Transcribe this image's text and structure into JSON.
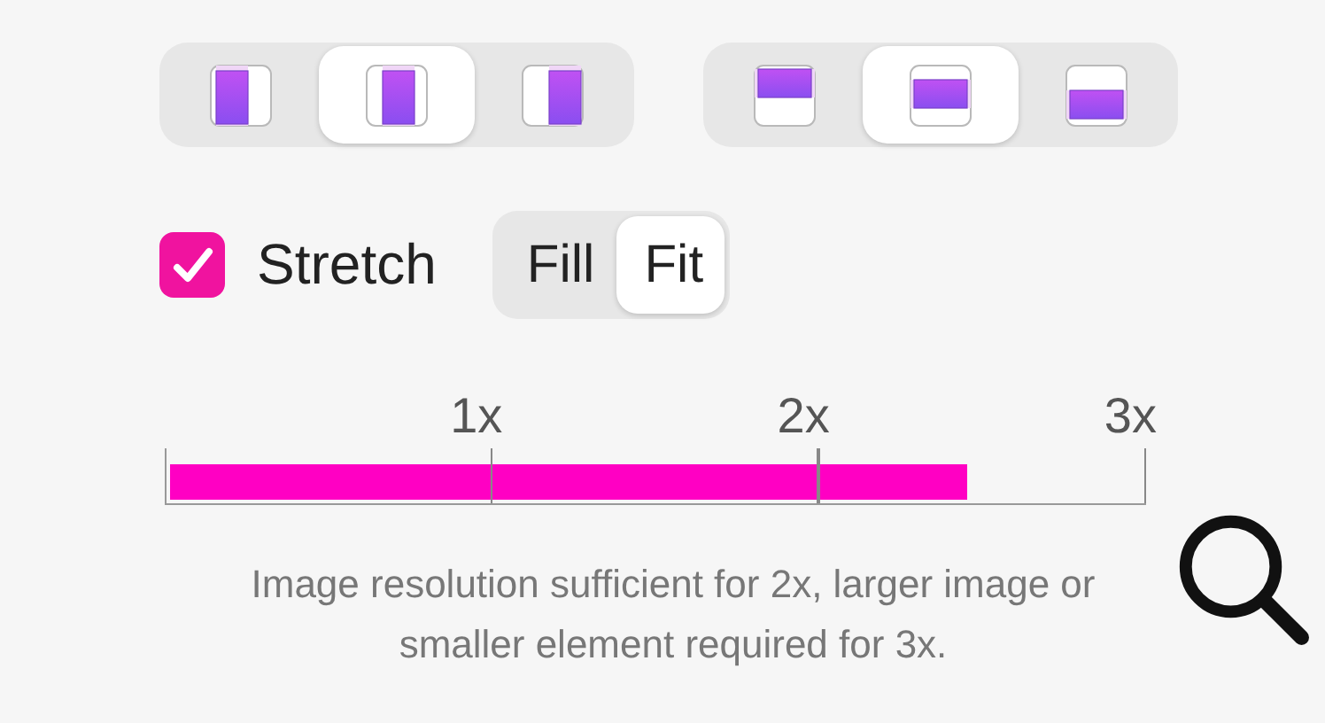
{
  "alignment_groups": [
    {
      "segments": [
        {
          "kind": "left",
          "selected": false
        },
        {
          "kind": "center",
          "selected": true
        },
        {
          "kind": "right",
          "selected": false
        }
      ]
    },
    {
      "segments": [
        {
          "kind": "top",
          "selected": false
        },
        {
          "kind": "middle",
          "selected": true
        },
        {
          "kind": "bottom",
          "selected": false
        }
      ]
    }
  ],
  "stretch": {
    "label": "Stretch",
    "checked": true
  },
  "scale_mode": [
    {
      "label": "Fill",
      "selected": false
    },
    {
      "label": "Fit",
      "selected": true
    }
  ],
  "resolution": {
    "ticks": [
      "1x",
      "2x",
      "3x"
    ],
    "level": 0.818,
    "message": "Image resolution sufficient for 2x, larger image or smaller element required for 3x."
  }
}
